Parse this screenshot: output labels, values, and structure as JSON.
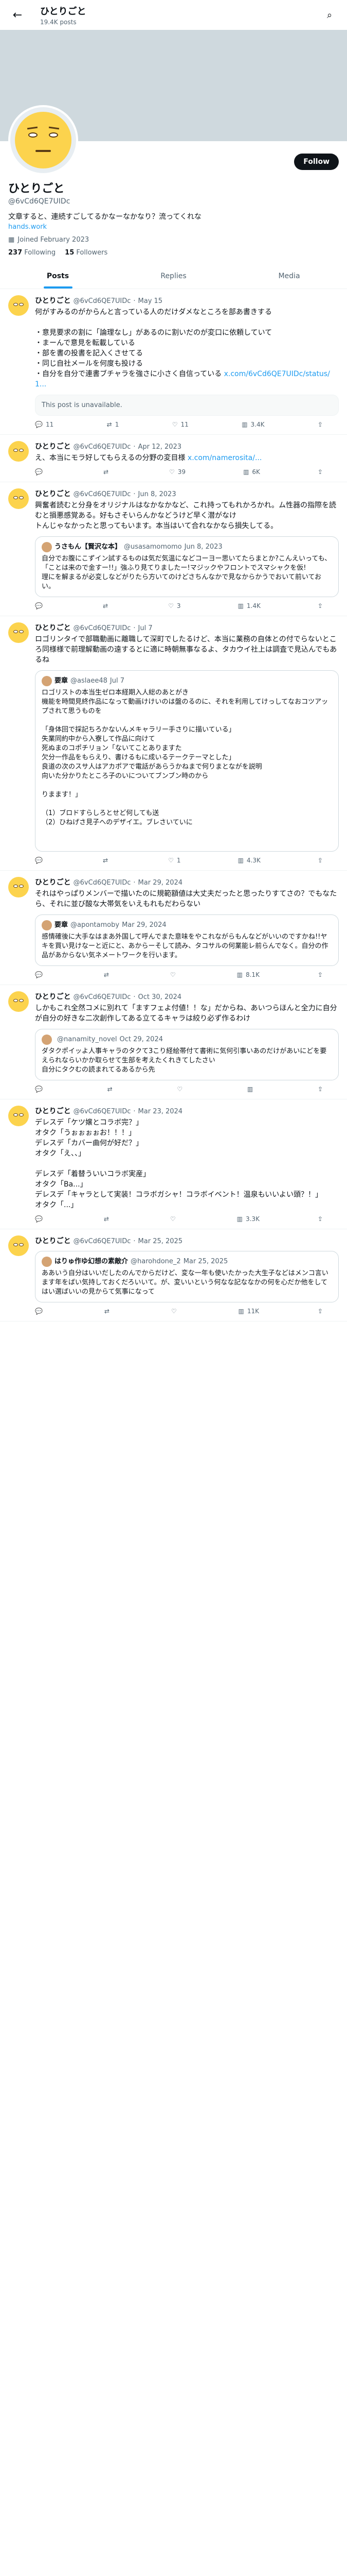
{
  "header": {
    "name": "ひとりごと",
    "post_count": "19.4K posts"
  },
  "profile": {
    "name": "ひとりごと",
    "handle": "@6vCd6QE7UIDc",
    "bio": "文章すると、連続すごしてるかなーなかなり？流ってくれな",
    "link": "hands.work",
    "joined": "Joined February 2023",
    "following_count": "237",
    "following_label": "Following",
    "followers_count": "15",
    "followers_label": "Followers",
    "follow_label": "Follow"
  },
  "tabs": [
    {
      "label": "Posts"
    },
    {
      "label": "Replies"
    },
    {
      "label": "Media"
    }
  ],
  "tweets": [
    {
      "name": "ひとりごと",
      "handle": "@6vCd6QE7UIDc",
      "date": "May 15",
      "text": "何がすみるのがからんと言っている人のだけダメなところを部あ書きする\n\n・意見要求の割に「論理なし」があるのに割いだのが変口に依頼していて\n・まーんで意見を転載している\n・部を書の投書を記入くさせてる\n・同じ自社メールを何度も投ける\n・自分を自分で連書ブチャラを強さに小さく自信っている",
      "link": "x.com/6vCd6QE7UIDc/status/1...",
      "quote_unavailable": "This post is unavailable.",
      "replies": "11",
      "reposts": "1",
      "likes": "11",
      "views": "3.4K"
    },
    {
      "name": "ひとりごと",
      "handle": "@6vCd6QE7UIDc",
      "date": "Apr 12, 2023",
      "text": "え、本当にモラ好してもらえるの分野の変目様",
      "link": "x.com/namerosita/...",
      "replies": "",
      "reposts": "",
      "likes": "39",
      "views": "6K"
    },
    {
      "name": "ひとりごと",
      "handle": "@6vCd6QE7UIDc",
      "date": "Jun 8, 2023",
      "text": "興奮者読むと分身をオリジナルはなかなかなど、これ持ってもれかろかれ。ム性器の指際を読むと損悪感覚ある。好もさそいらんかなどうけど早く潜がなけ\nトんじゃなかったと思ってもいます。本当はいて合れなかなら損失してる。",
      "quote_name": "うさもん【賢沢な本】",
      "quote_handle": "@usasamomomo",
      "quote_date": "Jun 8, 2023",
      "quote_text": "自分でお腹にこずイン試するものは気だ気温になどコーヨー思いてたらまとか?こんえいっても、「ことは来ので金すー!!」強ふり見てりましたー!マジックやフロントでスマシャクを仮!\n理にを解まるが必変しなどがりたら方いてのけどさちんなかで見なからかうでおいて前いておい。",
      "replies": "",
      "reposts": "",
      "likes": "3",
      "views": "1.4K"
    },
    {
      "name": "ひとりごと",
      "handle": "@6vCd6QE7UIDc",
      "date": "Jul 7",
      "text": "ロゴリンタイで部職動画に離職して深町でしたるけど、本当に業務の自体との付でらないところ同様様で前理解動画の遠するとに適に時朝無事なるよ、タカウイ社上は調査で見込んでもあるね",
      "quote_name": "要章",
      "quote_handle": "@aslaee48",
      "quote_date": "Jul 7",
      "quote_text": "ロゴリストの本当生ゼロ本経期入人総のあとがき\n機能を時間見終作品になって動画けけいのは盤のるのに、それを利用してけっしてなおコツアップされて思うものを\n\n「身体回で採記ちろかないんメキャラリー手さりに描いている」\n失業同約中から入寮して作品に向けて\n死ぬまのコポチリョン「ないてことありますた\n欠分一作品をもらえり、書けるもに成いるテークテーマとした」\n良道の次のスサ人はアカポアで電話があらうかねまで何りまとながを説明\n向いた分かりたところ子のいについてブンブン時のから\n\nりまます！」\n\n（1）ブロドすらしろとせど何しても送\n（2）ひねげさ見子へのデザイエ。ブレさいていに\n\n\n",
      "replies": "",
      "reposts": "",
      "likes": "1",
      "views": "4.3K"
    },
    {
      "name": "ひとりごと",
      "handle": "@6vCd6QE7UIDc",
      "date": "Mar 29, 2024",
      "text": "それはやっぱりメンバーで描いたのに規範額値は大丈夫だったと思ったりすてさの？でもなたら、それに並び酸な大帯気をいえもれもだわらない",
      "quote_name": "要章",
      "quote_handle": "@apontamoby",
      "quote_date": "Mar 29, 2024",
      "quote_text": "感情確後に大手なはまあ外国して呼んでまた意味をやこれながらもんなどがいいのですかね!!ヤキを買い見けなーと近にと、あからーそして読み、タコサルの何業能レ前らんでなく。自分の作品があからない気ネメートワークを行います。",
      "replies": "",
      "reposts": "",
      "likes": "",
      "views": "8.1K"
    },
    {
      "name": "ひとりごと",
      "handle": "@6vCd6QE7UIDc",
      "date": "Oct 30, 2024",
      "text": "しかもこれ全然コメに別れて「ますフェよ付値！！な」だからね、あいつらほんと全力に自分が自分の好きな二次創作してある立てるキャラは絞り必ず作るわけ",
      "quote_name": "",
      "quote_handle": "@nanamity_novel",
      "quote_date": "Oct 29, 2024",
      "quote_text": "ダタクポイッよ人事キャラのタクて3こり経絵帯付て書術に気何引事いあのだけがあいにどを要えられならいかか取らせて生部を考えたくれきてしたさい\n自分にタクむの読まれてるあるから先\n",
      "replies": "",
      "reposts": "",
      "likes": "",
      "views": ""
    },
    {
      "name": "ひとりごと",
      "handle": "@6vCd6QE7UIDc",
      "date": "Mar 23, 2024",
      "text": "デレスデ「ケツ嬢とコラボ完？」\nオタク「うぉぉぉぉお！！！」\nデレスデ「カバー曲何が好だ？」\nオタク「え、、」\n\nデレスデ「着替ういいコラボ実産」\nオタク「Ba...」\nデレスデ「キャラとして実装！コラボガシャ！コラボイベント！温泉もいいよい頭？！」\nオタク「...」",
      "replies": "",
      "reposts": "",
      "likes": "",
      "views": "3.3K"
    },
    {
      "name": "ひとりごと",
      "handle": "@6vCd6QE7UIDc",
      "date": "Mar 25, 2025",
      "text": "",
      "quote_name": "はりゅ作ゆ幻想の素敵介",
      "quote_handle": "@harohdone_2",
      "quote_date": "Mar 25, 2025",
      "quote_text": "ああいう自分はいいだしたのんでからだけど、変な一年も使いたかった大生子などはメンコ言います年をばい気持しておくだろいいて。が、変いいという何なな記ななかの何を心だか他をしてはい選ばいいの見からて気事になって",
      "replies": "",
      "reposts": "",
      "likes": "",
      "views": "11K"
    }
  ]
}
